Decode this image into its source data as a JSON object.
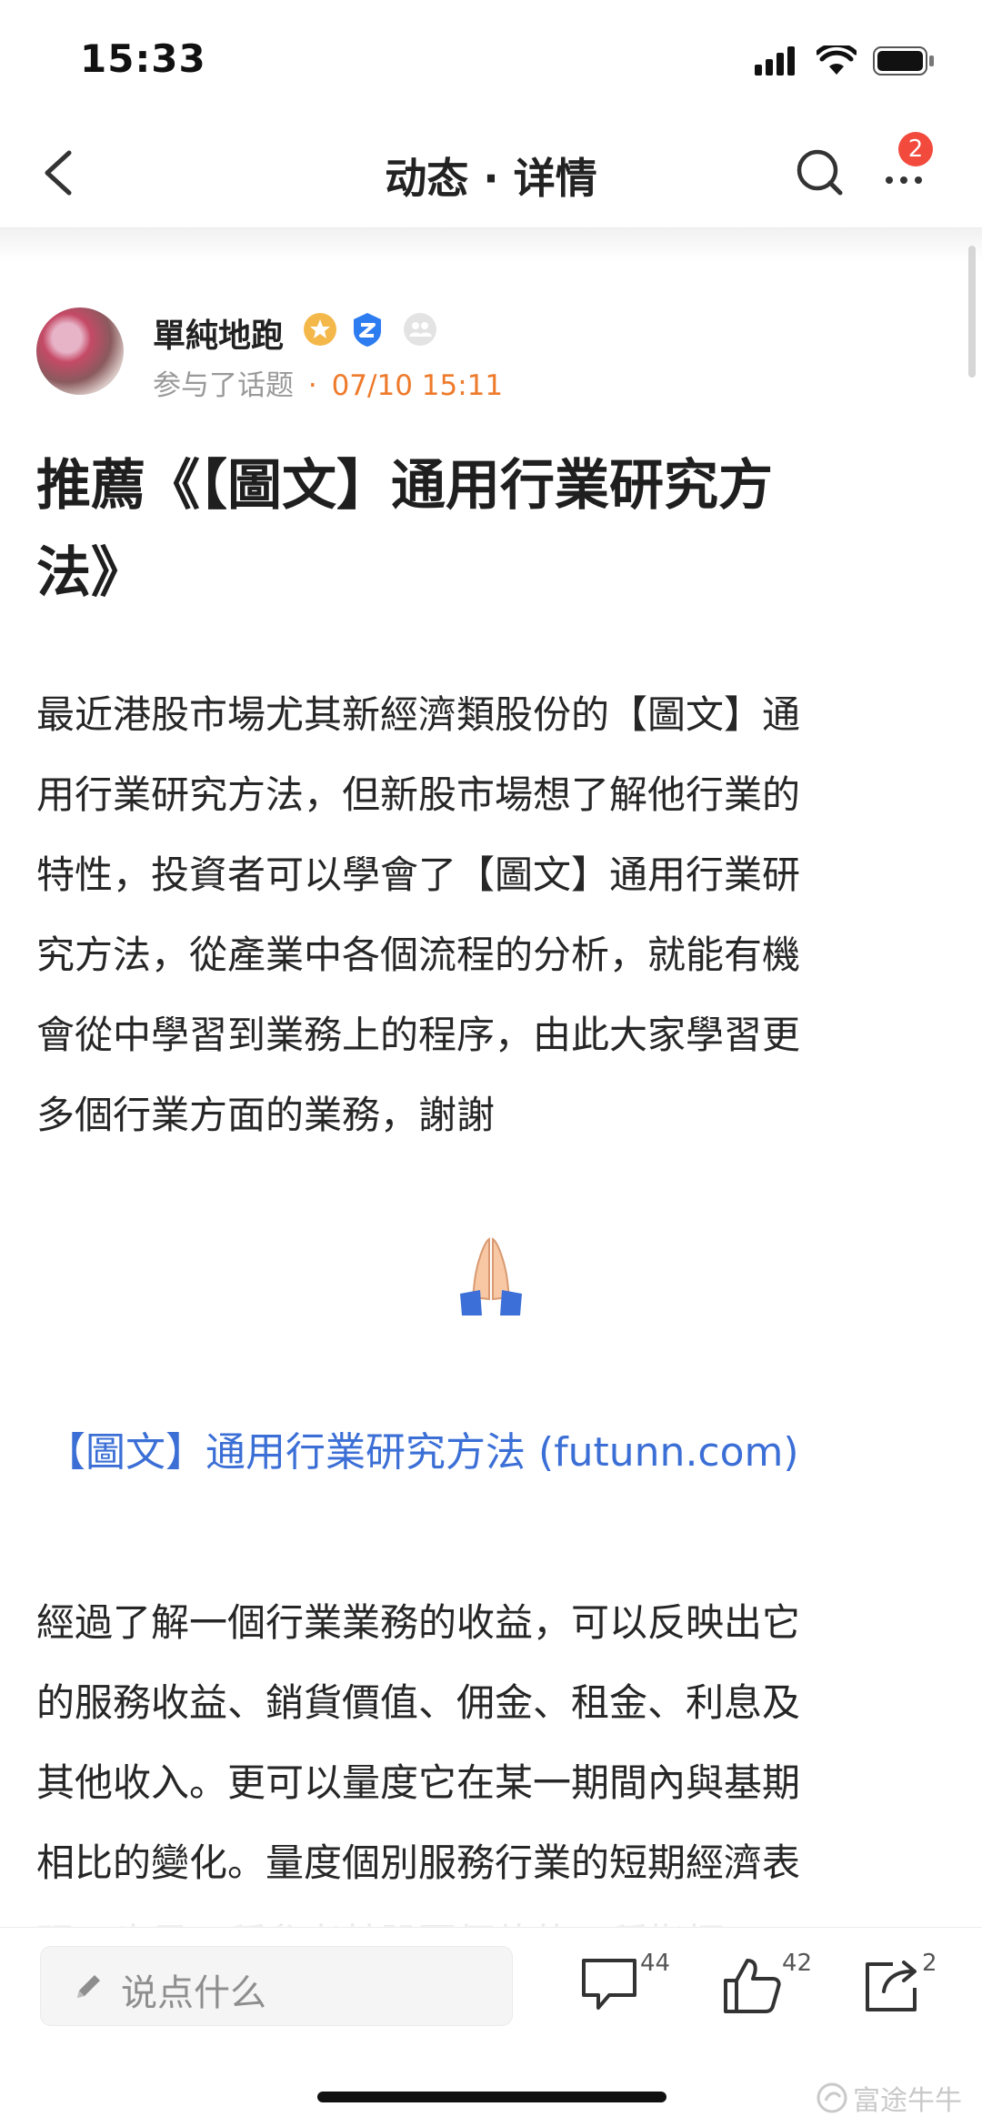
{
  "status_bar": {
    "time": "15:33"
  },
  "nav": {
    "title": "动态 · 详情",
    "badge_count": "2"
  },
  "post": {
    "author": "單純地跑",
    "meta_text": "参与了话题",
    "dot": "·",
    "date": "07/10 15:11",
    "title_line1": "推薦《【圖文】通用行業研究方",
    "title_line2": "法》",
    "para1": "最近港股市場尤其新經濟類股份的【圖文】通\n用行業研究方法，但新股市場想了解他行業的\n特性，投資者可以學會了【圖文】通用行業研\n究方法，從產業中各個流程的分析，就能有機\n會從中學習到業務上的程序，由此大家學習更\n多個行業方面的業務，謝謝",
    "link_text": "【圖文】通用行業研究方法 (futunn.com)",
    "para2": "經過了解一個行業業務的收益，可以反映出它\n的服務收益、銷貨價值、佣金、租金、利息及\n其他收入。更可以量度它在某一期間內與基期\n相比的變化。量度個別服務行業的短期經濟表\n現，也是一種參考某股票價值的一種指標。"
  },
  "bottom_bar": {
    "comment_placeholder": "说点什么",
    "comments_count": "44",
    "likes_count": "42",
    "shares_count": "2"
  },
  "watermark": "富途牛牛",
  "icons": [
    "back-icon",
    "search-icon",
    "more-icon",
    "verified-gold-icon",
    "verified-blue-icon",
    "follow-icon",
    "pray-emoji-icon",
    "pencil-icon",
    "comment-icon",
    "like-icon",
    "share-icon"
  ],
  "colors": {
    "accent_link": "#3b6fd6",
    "date": "#ee7a2b",
    "badge": "#f24a3d"
  }
}
